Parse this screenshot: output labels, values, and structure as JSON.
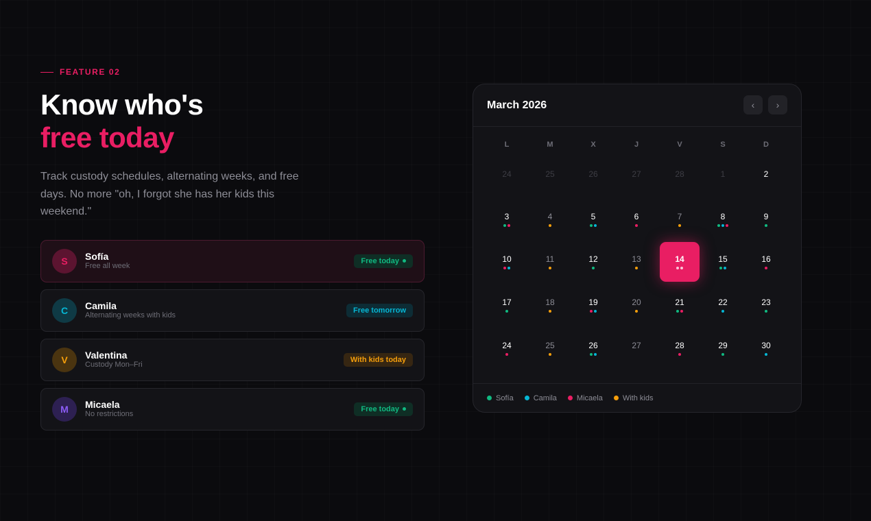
{
  "colors": {
    "accent": "#e91e63",
    "sofia": "#10b981",
    "camila": "#06b6d4",
    "micaela": "#e91e63",
    "kids": "#f59e0b"
  },
  "feature": {
    "eyebrow": "FEATURE 02",
    "title_line1": "Know who's",
    "title_line2": "free today",
    "description": "Track custody schedules, alternating weeks, and free days. No more \"oh, I forgot she has her kids this weekend.\""
  },
  "people": [
    {
      "initial": "S",
      "name": "Sofía",
      "subtitle": "Free all week",
      "badge": "Free today",
      "badge_dot": true,
      "active": true,
      "avatar_bg": "#5c1430",
      "avatar_fg": "#e91e63",
      "badge_bg": "#0f2e25",
      "badge_fg": "#10b981"
    },
    {
      "initial": "C",
      "name": "Camila",
      "subtitle": "Alternating weeks with kids",
      "badge": "Free tomorrow",
      "badge_dot": false,
      "active": false,
      "avatar_bg": "#0f3a45",
      "avatar_fg": "#06b6d4",
      "badge_bg": "#0d2c35",
      "badge_fg": "#06b6d4"
    },
    {
      "initial": "V",
      "name": "Valentina",
      "subtitle": "Custody Mon–Fri",
      "badge": "With kids today",
      "badge_dot": false,
      "active": false,
      "avatar_bg": "#4a3410",
      "avatar_fg": "#f59e0b",
      "badge_bg": "#362612",
      "badge_fg": "#f59e0b"
    },
    {
      "initial": "M",
      "name": "Micaela",
      "subtitle": "No restrictions",
      "badge": "Free today",
      "badge_dot": true,
      "active": false,
      "avatar_bg": "#2d2052",
      "avatar_fg": "#8b5cf6",
      "badge_bg": "#0f2e25",
      "badge_fg": "#10b981"
    }
  ],
  "calendar": {
    "title": "March 2026",
    "prev_label": "‹",
    "next_label": "›",
    "weekdays": [
      "L",
      "M",
      "X",
      "J",
      "V",
      "S",
      "D"
    ],
    "weeks": [
      [
        {
          "d": "24",
          "m": true,
          "dots": []
        },
        {
          "d": "25",
          "m": true,
          "dots": []
        },
        {
          "d": "26",
          "m": true,
          "dots": []
        },
        {
          "d": "27",
          "m": true,
          "dots": []
        },
        {
          "d": "28",
          "m": true,
          "dots": []
        },
        {
          "d": "1",
          "m": true,
          "dots": []
        },
        {
          "d": "2",
          "dots": []
        }
      ],
      [
        {
          "d": "3",
          "dots": [
            "sofia",
            "micaela"
          ]
        },
        {
          "d": "4",
          "dots": [
            "kids"
          ]
        },
        {
          "d": "5",
          "dots": [
            "sofia",
            "camila"
          ]
        },
        {
          "d": "6",
          "dots": [
            "micaela"
          ]
        },
        {
          "d": "7",
          "dots": [
            "kids"
          ]
        },
        {
          "d": "8",
          "dots": [
            "sofia",
            "camila",
            "micaela"
          ]
        },
        {
          "d": "9",
          "dots": [
            "sofia"
          ]
        }
      ],
      [
        {
          "d": "10",
          "dots": [
            "micaela",
            "camila"
          ]
        },
        {
          "d": "11",
          "dots": [
            "kids"
          ]
        },
        {
          "d": "12",
          "dots": [
            "sofia"
          ]
        },
        {
          "d": "13",
          "dots": [
            "kids"
          ]
        },
        {
          "d": "14",
          "today": true,
          "dots": [
            "white",
            "white"
          ]
        },
        {
          "d": "15",
          "dots": [
            "sofia",
            "camila"
          ]
        },
        {
          "d": "16",
          "dots": [
            "micaela"
          ]
        }
      ],
      [
        {
          "d": "17",
          "dots": [
            "sofia"
          ]
        },
        {
          "d": "18",
          "dots": [
            "kids"
          ]
        },
        {
          "d": "19",
          "dots": [
            "micaela",
            "camila"
          ]
        },
        {
          "d": "20",
          "dots": [
            "kids"
          ]
        },
        {
          "d": "21",
          "dots": [
            "sofia",
            "micaela"
          ]
        },
        {
          "d": "22",
          "dots": [
            "camila"
          ]
        },
        {
          "d": "23",
          "dots": [
            "sofia"
          ]
        }
      ],
      [
        {
          "d": "24",
          "dots": [
            "micaela"
          ]
        },
        {
          "d": "25",
          "dots": [
            "kids"
          ]
        },
        {
          "d": "26",
          "dots": [
            "sofia",
            "camila"
          ]
        },
        {
          "d": "27",
          "dots": []
        },
        {
          "d": "28",
          "dots": [
            "micaela"
          ]
        },
        {
          "d": "29",
          "dots": [
            "sofia"
          ]
        },
        {
          "d": "30",
          "dots": [
            "camila"
          ]
        }
      ]
    ],
    "legend": [
      {
        "key": "sofia",
        "label": "Sofía"
      },
      {
        "key": "camila",
        "label": "Camila"
      },
      {
        "key": "micaela",
        "label": "Micaela"
      },
      {
        "key": "kids",
        "label": "With kids"
      }
    ]
  }
}
